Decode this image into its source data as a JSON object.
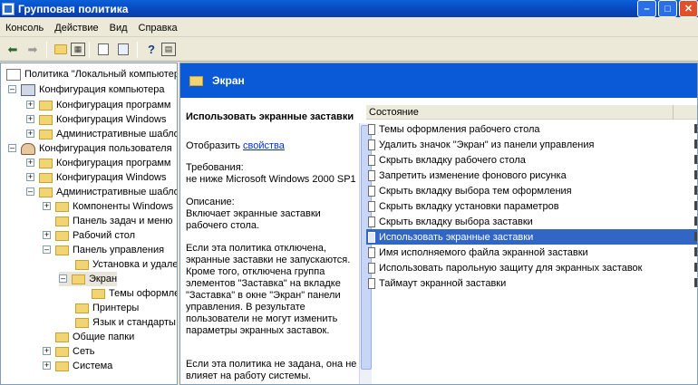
{
  "window": {
    "title": "Групповая политика"
  },
  "menu": [
    {
      "label": "Консоль"
    },
    {
      "label": "Действие"
    },
    {
      "label": "Вид"
    },
    {
      "label": "Справка"
    }
  ],
  "tree": {
    "root": "Политика \"Локальный компьютер\"",
    "items": [
      {
        "label": "Конфигурация компьютера"
      },
      {
        "label": "Конфигурация программ"
      },
      {
        "label": "Конфигурация Windows"
      },
      {
        "label": "Административные шаблоны"
      },
      {
        "label": "Конфигурация пользователя"
      },
      {
        "label": "Конфигурация программ"
      },
      {
        "label": "Конфигурация Windows"
      },
      {
        "label": "Административные шаблоны"
      },
      {
        "label": "Компоненты Windows"
      },
      {
        "label": "Панель задач и меню"
      },
      {
        "label": "Рабочий стол"
      },
      {
        "label": "Панель управления"
      },
      {
        "label": "Установка и удаление"
      },
      {
        "label": "Экран"
      },
      {
        "label": "Темы оформления"
      },
      {
        "label": "Принтеры"
      },
      {
        "label": "Язык и стандарты"
      },
      {
        "label": "Общие папки"
      },
      {
        "label": "Сеть"
      },
      {
        "label": "Система"
      }
    ]
  },
  "panel": {
    "title": "Экран"
  },
  "description": {
    "title": "Использовать экранные заставки",
    "show_prefix": "Отобразить",
    "show_link": "свойства",
    "requirements_label": "Требования:",
    "requirements_text": "не ниже Microsoft Windows 2000 SP1",
    "desc_label": "Описание:",
    "desc_text": "Включает экранные заставки рабочего стола.",
    "p1": "Если эта политика отключена, экранные заставки не запускаются. Кроме того, отключена группа элементов \"Заставка\" на вкладке \"Заставка\" в окне \"Экран\" панели управления. В результате пользователи не могут изменить параметры экранных заставок.",
    "p2": "Если эта политика не задана, она не влияет на работу системы."
  },
  "list": {
    "header": "Состояние",
    "rows": [
      {
        "label": "Темы оформления рабочего стола"
      },
      {
        "label": "Удалить значок \"Экран\" из панели управления"
      },
      {
        "label": "Скрыть вкладку рабочего стола"
      },
      {
        "label": "Запретить изменение фонового рисунка"
      },
      {
        "label": "Скрыть вкладку выбора тем оформления"
      },
      {
        "label": "Скрыть вкладку установки параметров"
      },
      {
        "label": "Скрыть вкладку выбора заставки"
      },
      {
        "label": "Использовать экранные заставки"
      },
      {
        "label": "Имя исполняемого файла экранной заставки"
      },
      {
        "label": "Использовать парольную защиту для экранных заставок"
      },
      {
        "label": "Таймаут экранной заставки"
      }
    ],
    "selected_index": 7
  }
}
